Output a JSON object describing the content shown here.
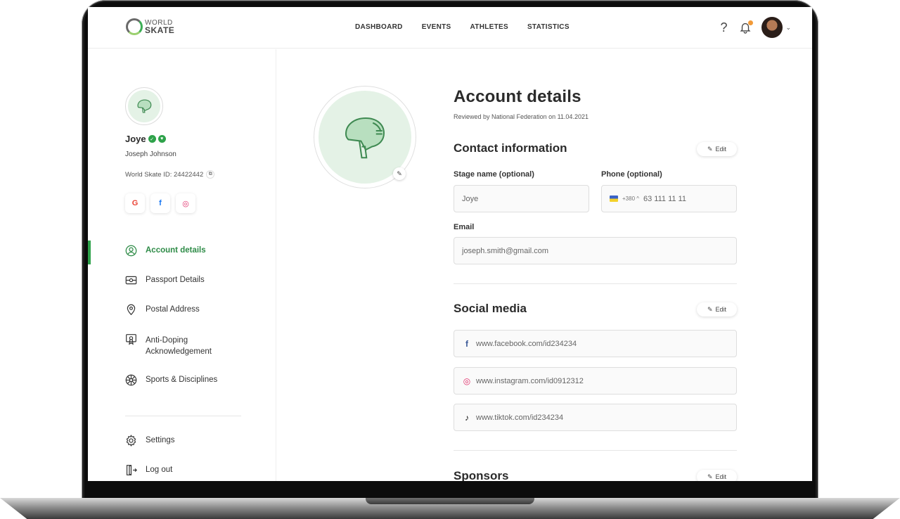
{
  "brand": {
    "logo_line1": "WORLD",
    "logo_line2": "SKATE",
    "accent": "#2ea24a"
  },
  "nav": {
    "items": [
      {
        "label": "DASHBOARD"
      },
      {
        "label": "EVENTS"
      },
      {
        "label": "ATHLETES"
      },
      {
        "label": "STATISTICS"
      }
    ],
    "help_glyph": "?"
  },
  "profile": {
    "display_name": "Joye",
    "full_name": "Joseph Johnson",
    "world_skate_id": "World Skate ID: 24422442",
    "socials": [
      {
        "icon": "google-icon",
        "glyph": "G",
        "color": "#ea4335"
      },
      {
        "icon": "facebook-icon",
        "glyph": "f",
        "color": "#1877f2"
      },
      {
        "icon": "instagram-icon",
        "glyph": "◎",
        "color": "#e1306c"
      }
    ]
  },
  "menu": {
    "items": [
      {
        "label": "Account details",
        "icon": "user-circle-icon",
        "active": true
      },
      {
        "label": "Passport Details",
        "icon": "passport-icon"
      },
      {
        "label": "Postal Address",
        "icon": "location-pin-icon"
      },
      {
        "label": "Anti-Doping Acknowledgement",
        "icon": "certificate-icon"
      },
      {
        "label": "Sports & Disciplines",
        "icon": "wheel-icon"
      }
    ],
    "bottom": [
      {
        "label": "Settings",
        "icon": "gear-icon"
      },
      {
        "label": "Log out",
        "icon": "logout-icon"
      }
    ]
  },
  "account": {
    "title": "Account details",
    "reviewed": "Reviewed by National Federation on 11.04.2021",
    "edit_label": "Edit",
    "contact": {
      "title": "Contact information",
      "stage_name_label": "Stage name (optional)",
      "stage_name_value": "Joye",
      "phone_label": "Phone (optional)",
      "phone_code": "+380 ^",
      "phone_value": "63 111 11 11",
      "email_label": "Email",
      "email_value": "joseph.smith@gmail.com"
    },
    "social_media": {
      "title": "Social media",
      "links": [
        {
          "icon": "facebook-icon",
          "glyph": "f",
          "color": "#1877f2",
          "value": "www.facebook.com/id234234"
        },
        {
          "icon": "instagram-icon",
          "glyph": "◎",
          "color": "#e1306c",
          "value": "www.instagram.com/id0912312"
        },
        {
          "icon": "tiktok-icon",
          "glyph": "♪",
          "color": "#111111",
          "value": "www.tiktok.com/id234234"
        }
      ]
    },
    "sponsors": {
      "title": "Sponsors"
    }
  }
}
